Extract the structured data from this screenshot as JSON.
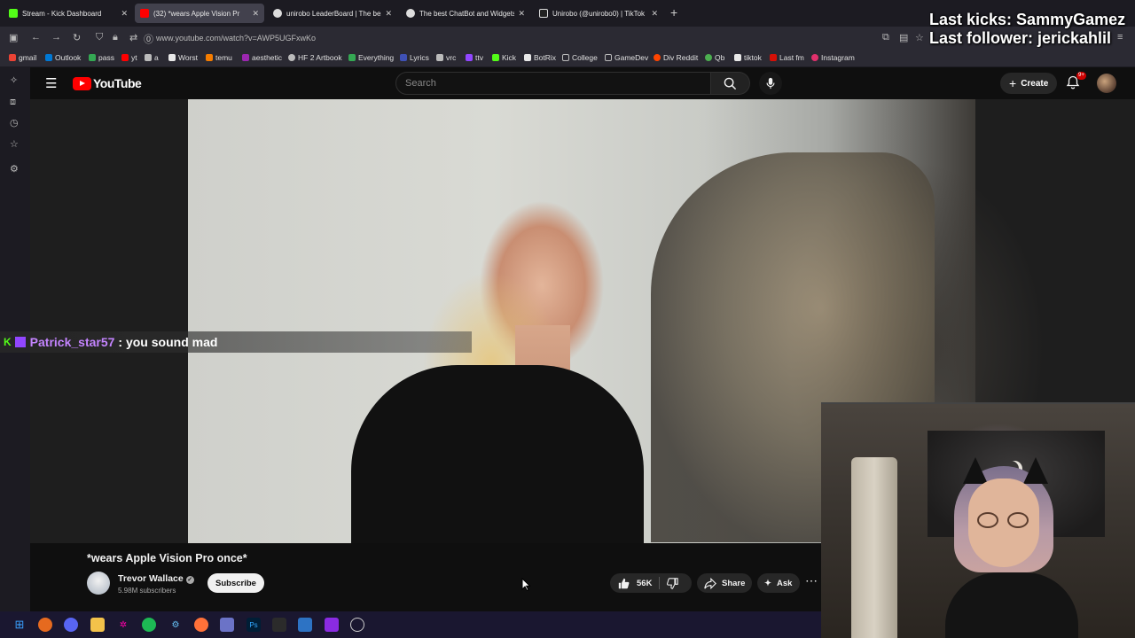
{
  "browser": {
    "tabs": [
      {
        "title": "Stream - Kick Dashboard",
        "favicon_color": "#53fc18",
        "active": false
      },
      {
        "title": "(32) *wears Apple Vision Pr",
        "favicon_color": "#ff0000",
        "active": true
      },
      {
        "title": "unirobo LeaderBoard | The best",
        "favicon_color": "#dddddd",
        "active": false
      },
      {
        "title": "The best ChatBot and Widgets",
        "favicon_color": "#dddddd",
        "active": false
      },
      {
        "title": "Unirobo (@unirobo0) | TikTok",
        "favicon_color": "#dddddd",
        "active": false
      }
    ],
    "url": "www.youtube.com/watch?v=AWP5UGFxwKo",
    "bookmarks": [
      {
        "label": "gmail",
        "color": "#ea4335"
      },
      {
        "label": "Outlook",
        "color": "#0078d4"
      },
      {
        "label": "pass",
        "color": "#34a853"
      },
      {
        "label": "yt",
        "color": "#ff0000"
      },
      {
        "label": "a",
        "color": "#bbbbbb"
      },
      {
        "label": "Worst",
        "color": "#e8e8e8"
      },
      {
        "label": "temu",
        "color": "#f57c00"
      },
      {
        "label": "aesthetic",
        "color": "#9c27b0"
      },
      {
        "label": "HF 2 Artbook",
        "color": "#bbbbbb"
      },
      {
        "label": "Everything",
        "color": "#34a853"
      },
      {
        "label": "Lyrics",
        "color": "#3f51b5"
      },
      {
        "label": "vrc",
        "color": "#bbbbbb"
      },
      {
        "label": "ttv",
        "color": "#9146ff"
      },
      {
        "label": "Kick",
        "color": "#53fc18"
      },
      {
        "label": "BotRix",
        "color": "#e8e8e8"
      },
      {
        "label": "College",
        "color": "#bbbbbb"
      },
      {
        "label": "GameDev",
        "color": "#bbbbbb"
      },
      {
        "label": "Div Reddit",
        "color": "#ff4500"
      },
      {
        "label": "Qb",
        "color": "#4caf50"
      },
      {
        "label": "tiktok",
        "color": "#e8e8e8"
      },
      {
        "label": "Last fm",
        "color": "#d51007"
      },
      {
        "label": "Instagram",
        "color": "#e1306c"
      }
    ]
  },
  "stream_overlay": {
    "last_kicks": "Last kicks: SammyGamez",
    "last_follower": "Last follower: jerickahlil"
  },
  "youtube": {
    "logo_text": "YouTube",
    "search_placeholder": "Search",
    "create_label": "Create",
    "notification_badge": "9+"
  },
  "chat": {
    "username": "Patrick_star57",
    "message": ": you sound mad"
  },
  "video": {
    "title": "*wears Apple Vision Pro once*",
    "channel": "Trevor Wallace",
    "subscribers": "5.98M subscribers",
    "subscribe_label": "Subscribe",
    "likes": "56K",
    "share_label": "Share",
    "ask_label": "Ask"
  },
  "taskbar": {
    "apps": [
      "windows",
      "firefox-alt",
      "discord",
      "files",
      "obs",
      "spotify",
      "steam",
      "firefox",
      "notepad",
      "photoshop",
      "terminal",
      "app-1",
      "app-2",
      "settings"
    ]
  }
}
